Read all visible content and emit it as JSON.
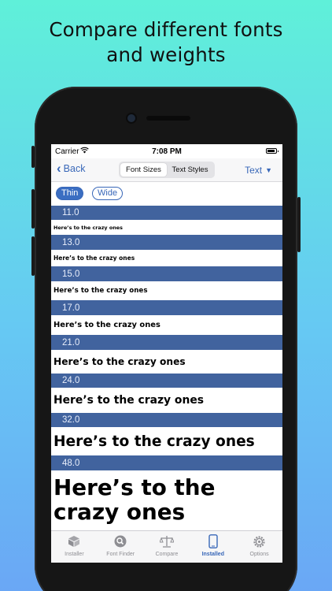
{
  "headline": {
    "line1": "Compare different fonts",
    "line2": "and weights"
  },
  "status": {
    "carrier": "Carrier",
    "time": "7:08 PM"
  },
  "nav": {
    "back_label": "Back",
    "segments": [
      "Font Sizes",
      "Text Styles"
    ],
    "selected_segment": "Font Sizes",
    "right_label": "Text",
    "right_icon": "triangle-down-icon",
    "accent": "#3867b8"
  },
  "weight_toggle": {
    "options": [
      "Thin",
      "Wide"
    ],
    "selected": "Thin"
  },
  "sample_text": "Here's to the crazy ones",
  "sizes": [
    {
      "label": "11.0",
      "value": 11,
      "text": "Here’s to the crazy ones"
    },
    {
      "label": "13.0",
      "value": 13,
      "text": "Here’s to the crazy ones"
    },
    {
      "label": "15.0",
      "value": 15,
      "text": "Here’s to the crazy ones"
    },
    {
      "label": "17.0",
      "value": 17,
      "text": "Here’s to the crazy ones"
    },
    {
      "label": "21.0",
      "value": 21,
      "text": "Here’s to the crazy ones"
    },
    {
      "label": "24.0",
      "value": 24,
      "text": "Here’s to the crazy ones"
    },
    {
      "label": "32.0",
      "value": 32,
      "text": "Here’s to the crazy ones"
    },
    {
      "label": "48.0",
      "value": 48,
      "text": "Here’s to the crazy ones"
    }
  ],
  "header_color": "#41639e",
  "tabs": [
    {
      "label": "Installer",
      "icon": "box-icon"
    },
    {
      "label": "Font Finder",
      "icon": "magnifier-icon"
    },
    {
      "label": "Compare",
      "icon": "scales-icon"
    },
    {
      "label": "Installed",
      "icon": "phone-icon",
      "active": true
    },
    {
      "label": "Options",
      "icon": "gear-icon"
    }
  ]
}
